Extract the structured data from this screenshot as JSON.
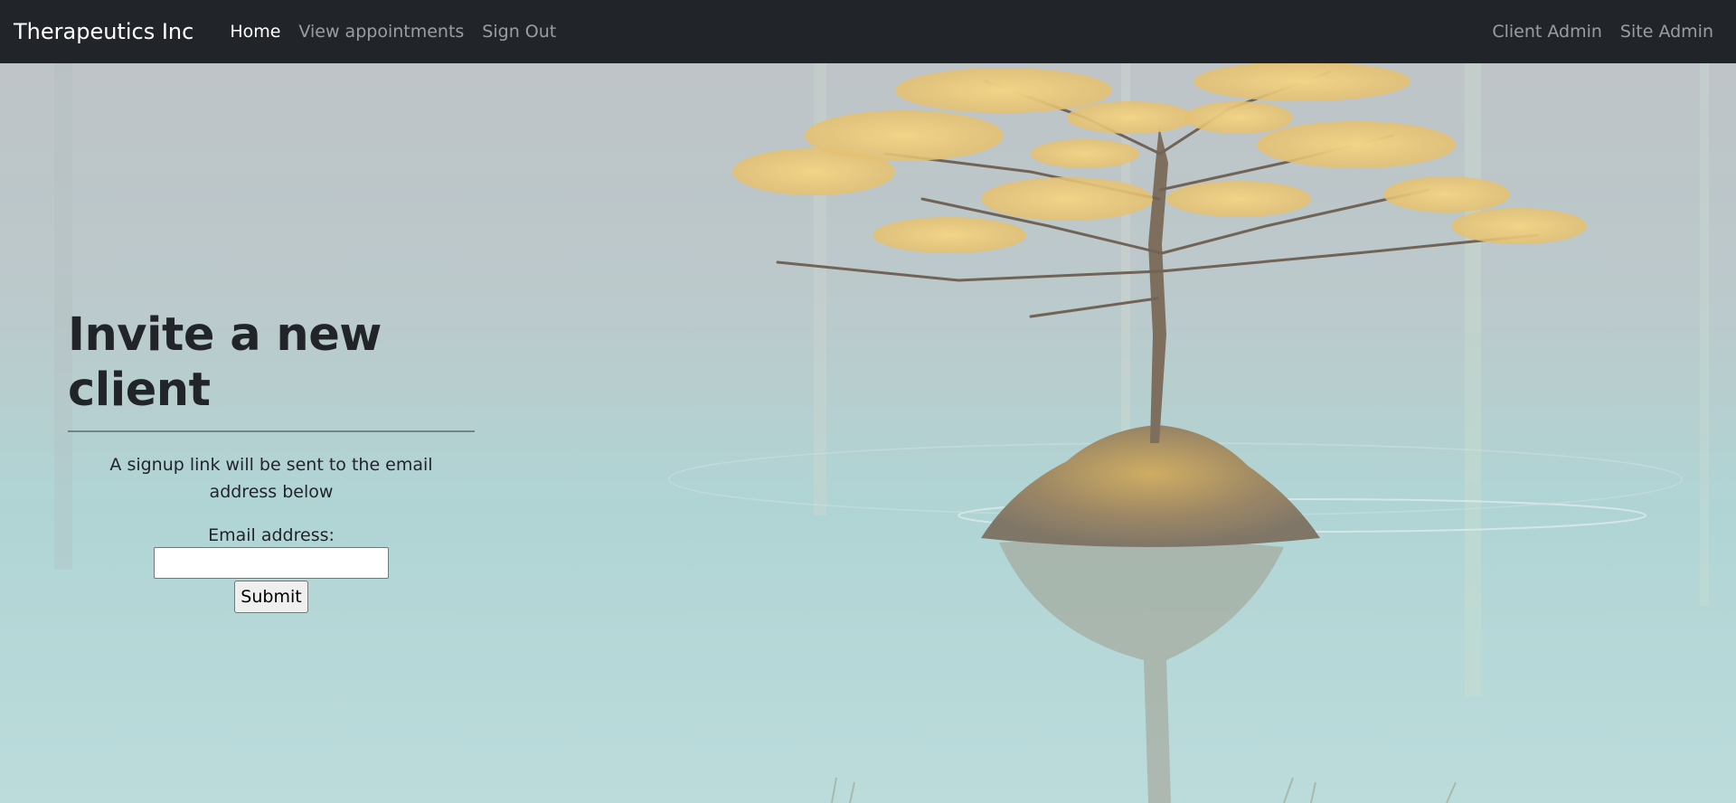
{
  "navbar": {
    "brand": "Therapeutics Inc",
    "links": [
      {
        "label": "Home",
        "active": true
      },
      {
        "label": "View appointments",
        "active": false
      },
      {
        "label": "Sign Out",
        "active": false
      }
    ],
    "right_links": [
      {
        "label": "Client Admin"
      },
      {
        "label": "Site Admin"
      }
    ]
  },
  "main": {
    "title": "Invite a new client",
    "description": "A signup link will be sent to the email address below",
    "form": {
      "email_label": "Email address:",
      "email_value": "",
      "submit_label": "Submit"
    }
  },
  "background": {
    "image_subject": "tree-on-island-in-lake",
    "colors": {
      "sky": "#b6bec2",
      "water": "#a7d4d3",
      "foliage": "#e8c36a",
      "trunk": "#6b5a48",
      "navbar": "#212529"
    }
  }
}
